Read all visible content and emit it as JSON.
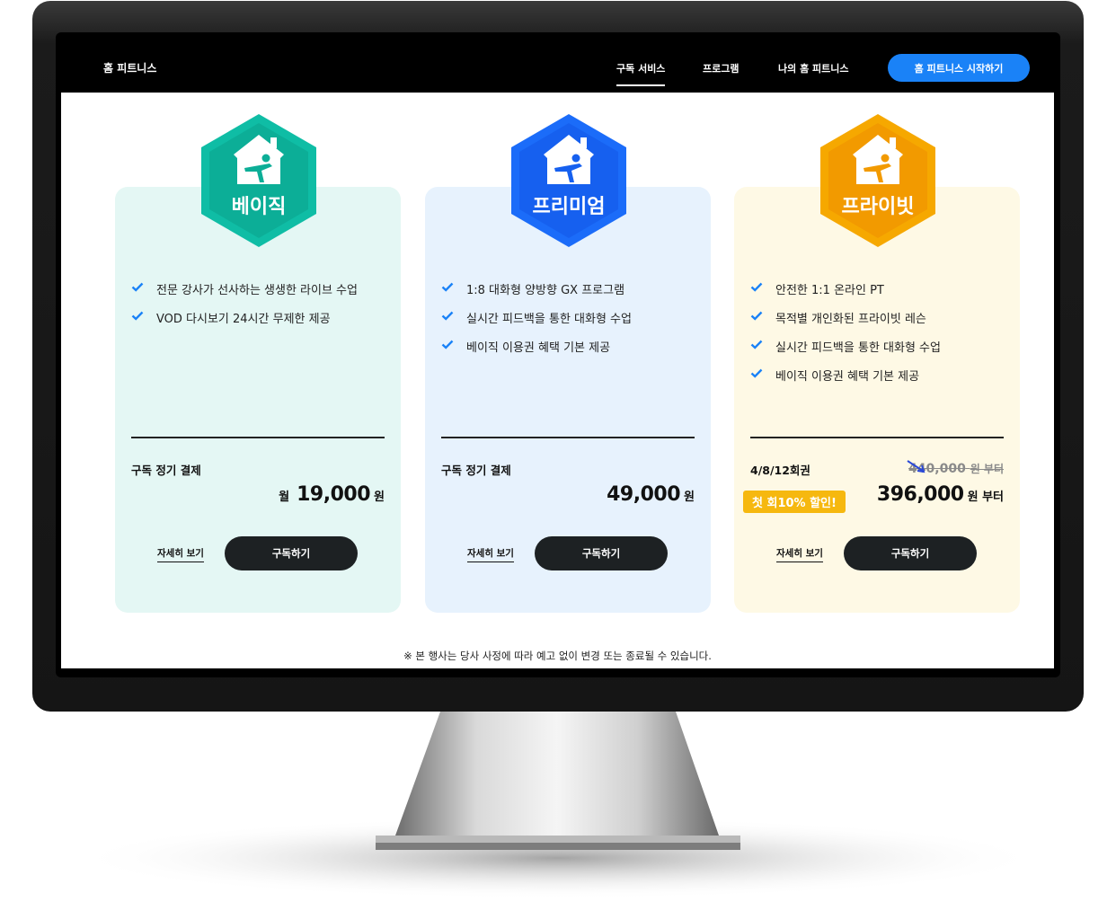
{
  "header": {
    "logo": "홈 피트니스",
    "nav": [
      {
        "label": "구독 서비스",
        "active": true
      },
      {
        "label": "프로그램",
        "active": false
      },
      {
        "label": "나의 홈 피트니스",
        "active": false
      }
    ],
    "cta_label": "홈 피트니스 시작하기"
  },
  "plans": [
    {
      "badge": "베이직",
      "badge_color": "#0fbda5",
      "features": [
        "전문 강사가 선사하는 생생한 라이브 수업",
        "VOD 다시보기 24시간 무제한 제공"
      ],
      "payment_label": "구독 정기 결제",
      "price_prefix": "월",
      "price": "19,000",
      "price_unit": "원",
      "detail_label": "자세히 보기",
      "button_label": "구독하기"
    },
    {
      "badge": "프리미엄",
      "badge_color": "#1b6cf9",
      "features": [
        "1:8 대화형 양방향 GX 프로그램",
        "실시간 피드백을 통한 대화형 수업",
        "베이직 이용권 혜택 기본 제공"
      ],
      "payment_label": "구독 정기 결제",
      "price": "49,000",
      "price_unit": "원",
      "detail_label": "자세히 보기",
      "button_label": "구독하기"
    },
    {
      "badge": "프라이빗",
      "badge_color": "#f6a800",
      "features": [
        "안전한 1:1 온라인 PT",
        "목적별 개인화된 프라이빗 레슨",
        "실시간 피드백을 통한 대화형 수업",
        "베이직 이용권 혜택 기본 제공"
      ],
      "payment_label": "4/8/12회권",
      "original_price": "440,000",
      "original_unit": "원 부터",
      "discount_label": "첫 회10% 할인!",
      "price": "396,000",
      "price_unit": "원 부터",
      "detail_label": "자세히 보기",
      "button_label": "구독하기"
    }
  ],
  "notice": "※ 본 행사는 당사 사정에 따라 예고 없이 변경 또는 종료될 수 있습니다.",
  "colors": {
    "check": "#1a82f7",
    "cta": "#1a82f7",
    "button_dark": "#1d2123"
  }
}
